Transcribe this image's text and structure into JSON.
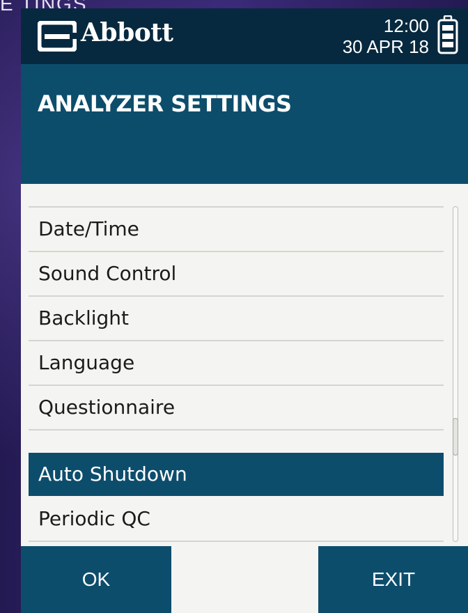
{
  "slide": {
    "title_fragment": "E TINGS"
  },
  "header": {
    "brand": "Abbott",
    "time": "12:00",
    "date": "30 APR 18"
  },
  "page": {
    "title": "ANALYZER SETTINGS"
  },
  "menu": {
    "items": [
      {
        "label": "Date/Time"
      },
      {
        "label": "Sound Control"
      },
      {
        "label": "Backlight"
      },
      {
        "label": "Language"
      },
      {
        "label": "Questionnaire"
      },
      {
        "label": "Auto Shutdown"
      },
      {
        "label": "Periodic QC"
      }
    ],
    "selected": "Auto Shutdown"
  },
  "softkeys": {
    "ok": "OK",
    "exit": "EXIT"
  },
  "colors": {
    "header_bg": "#07293f",
    "accent": "#0d4d6c",
    "list_bg": "#f4f4f2",
    "slide_bg": "#2a1f5a"
  },
  "icons": {
    "logo": "abbott-logo-icon",
    "battery": "battery-icon"
  }
}
